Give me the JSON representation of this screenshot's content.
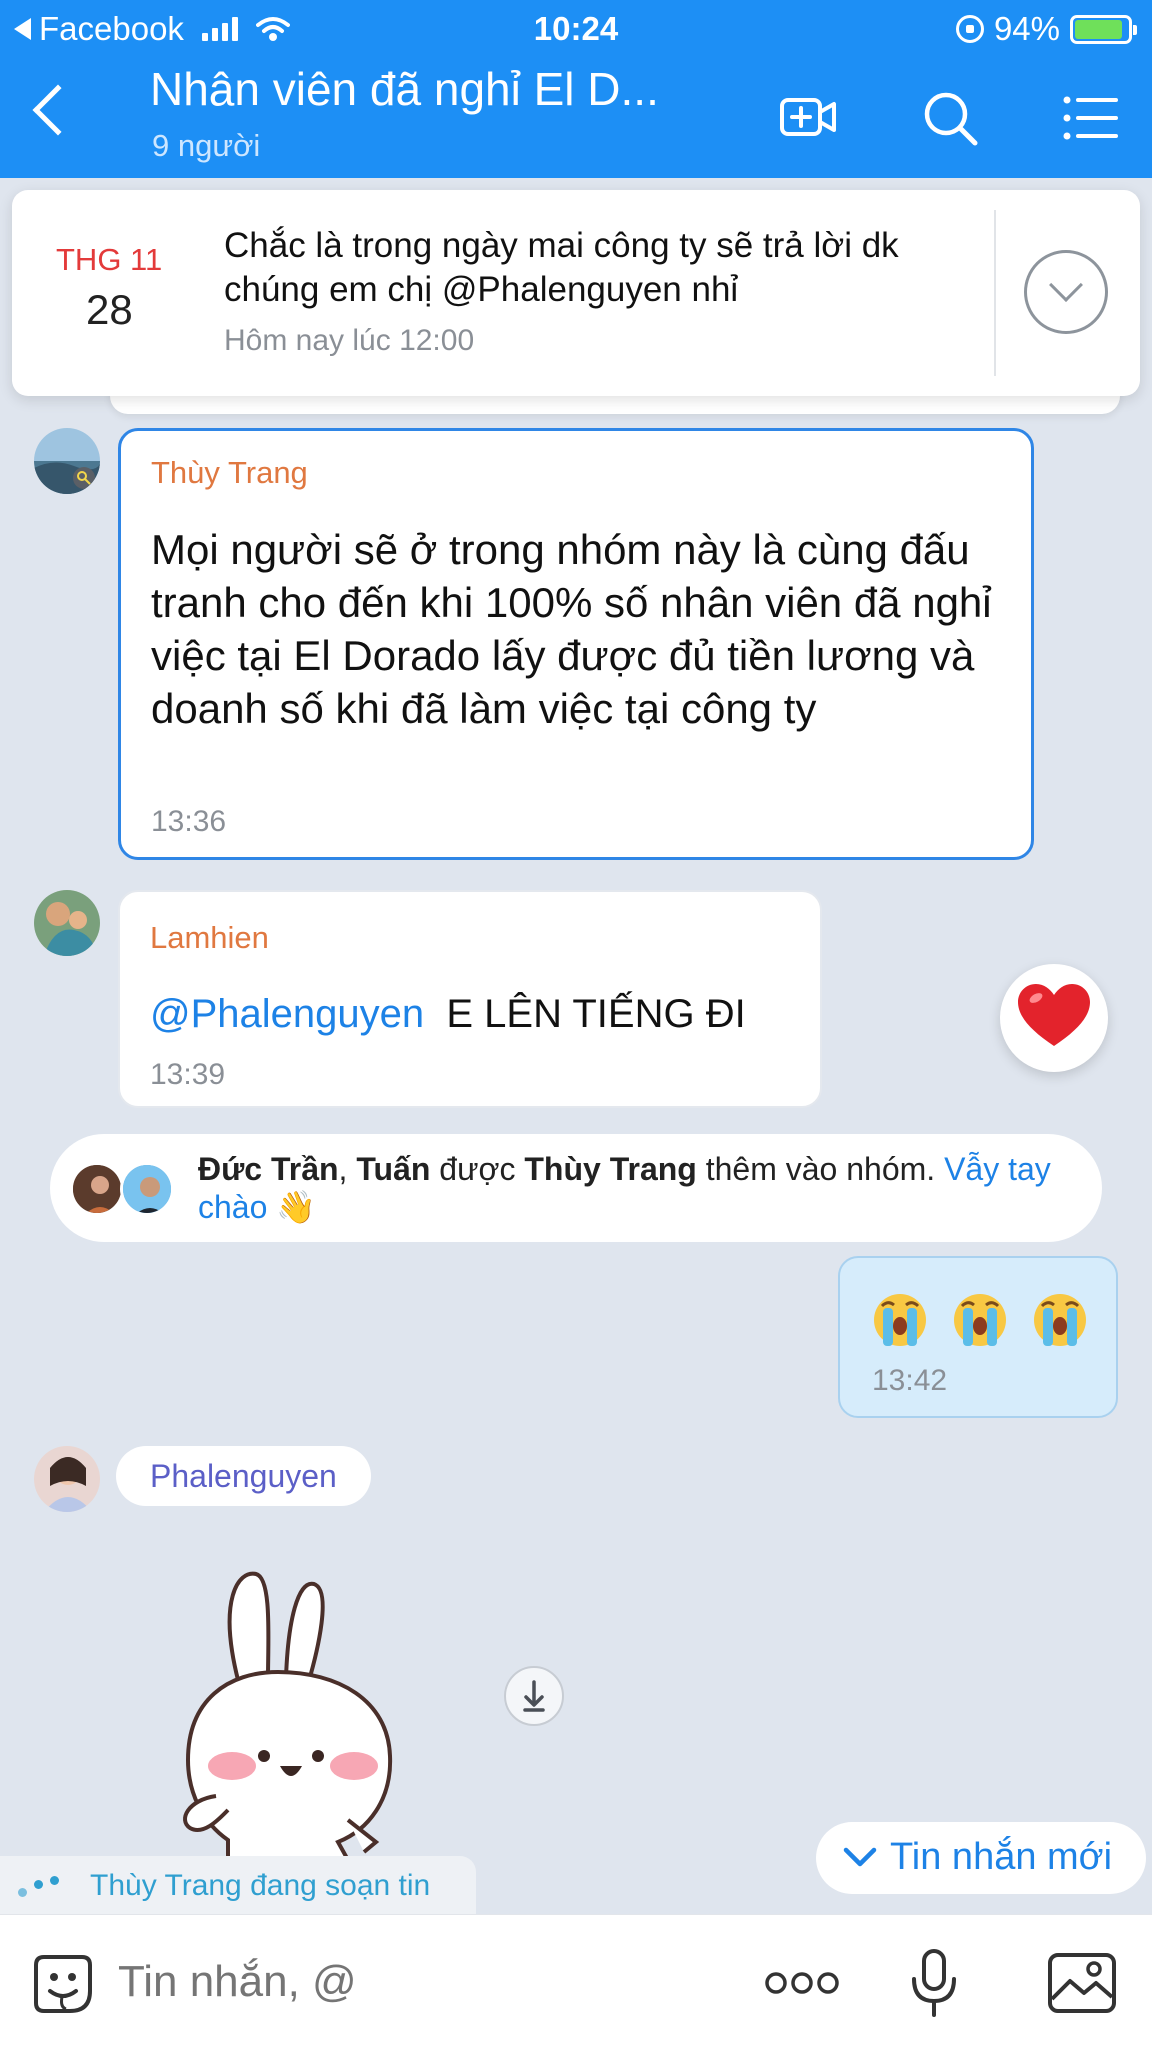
{
  "status_bar": {
    "back_app": "Facebook",
    "time": "10:24",
    "battery": "94%"
  },
  "header": {
    "title": "Nhân viên đã nghỉ El D...",
    "subtitle": "9 người"
  },
  "pinned": {
    "month": "THG 11",
    "day": "28",
    "text": "Chắc là trong ngày mai công ty sẽ trả lời dk chúng em chị @Phalenguyen nhỉ",
    "time": "Hôm nay lúc 12:00"
  },
  "messages": [
    {
      "sender": "Thùy Trang",
      "text": "Mọi người sẽ ở trong nhóm này là cùng đấu tranh cho đến khi 100% số nhân viên đã nghỉ việc tại El Dorado lấy được đủ tiền lương và doanh số khi đã làm việc tại công ty",
      "time": "13:36"
    },
    {
      "sender": "Lamhien",
      "mention": "@Phalenguyen",
      "text": "E LÊN TIẾNG ĐI",
      "time": "13:39"
    }
  ],
  "system_message": {
    "user1": "Đức Trần",
    "separator": ", ",
    "user2": "Tuấn",
    "middle": " được ",
    "inviter": "Thùy Trang",
    "action": " thêm vào nhóm. ",
    "link": "Vẫy tay chào",
    "emoji": "👋"
  },
  "my_message": {
    "time": "13:42"
  },
  "sticker_message": {
    "sender": "Phalenguyen"
  },
  "new_messages_label": "Tin nhắn mới",
  "typing_indicator": "Thùy Trang đang soạn tin",
  "input": {
    "placeholder": "Tin nhắn, @"
  },
  "colors": {
    "header_blue": "#1d8ff5",
    "chat_background": "#dfe5ee",
    "sender_name": "#e07840",
    "link": "#1d82e6",
    "own_bubble": "#d6ecfb"
  }
}
